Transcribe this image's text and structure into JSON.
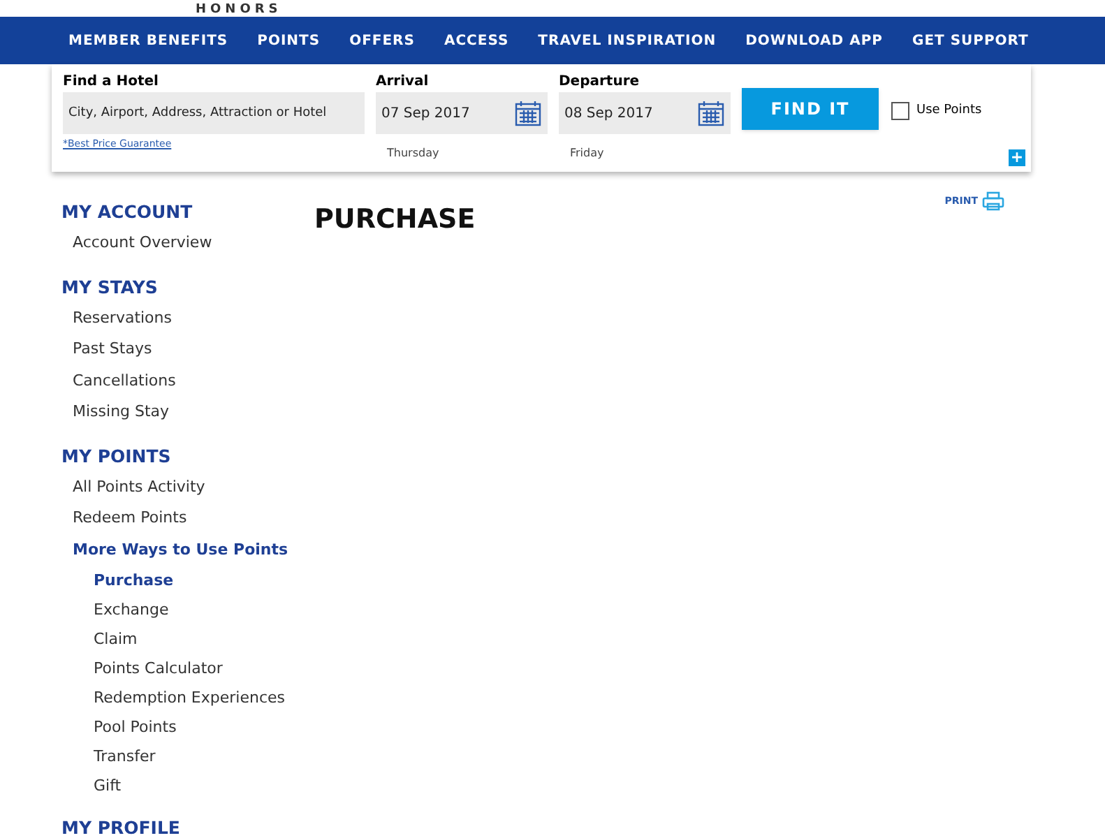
{
  "logo": {
    "text": "HONORS"
  },
  "nav": [
    "MEMBER BENEFITS",
    "POINTS",
    "OFFERS",
    "ACCESS",
    "TRAVEL INSPIRATION",
    "DOWNLOAD APP",
    "GET SUPPORT"
  ],
  "search": {
    "hotel_label": "Find a Hotel",
    "hotel_placeholder": "City, Airport, Address, Attraction or Hotel",
    "guarantee_link": "*Best Price Guarantee",
    "arrival": {
      "label": "Arrival",
      "value": "07 Sep 2017",
      "day": "Thursday"
    },
    "departure": {
      "label": "Departure",
      "value": "08 Sep 2017",
      "day": "Friday"
    },
    "button": "FIND IT",
    "use_points": {
      "label": "Use Points",
      "checked": false
    },
    "more": "+"
  },
  "sidebar": [
    {
      "heading": "MY ACCOUNT",
      "items": [
        {
          "label": "Account Overview",
          "selected": false
        }
      ]
    },
    {
      "heading": "MY STAYS",
      "items": [
        {
          "label": "Reservations",
          "selected": false
        },
        {
          "label": "Past Stays",
          "selected": false
        },
        {
          "label": "Cancellations",
          "selected": false
        },
        {
          "label": "Missing Stay",
          "selected": false
        }
      ]
    },
    {
      "heading": "MY POINTS",
      "items": [
        {
          "label": "All Points Activity",
          "selected": false
        },
        {
          "label": "Redeem Points",
          "selected": false
        },
        {
          "label": "More Ways to Use Points",
          "selected": false,
          "expanded": true,
          "children": [
            {
              "label": "Purchase",
              "selected": true
            },
            {
              "label": "Exchange",
              "selected": false
            },
            {
              "label": "Claim",
              "selected": false
            },
            {
              "label": "Points Calculator",
              "selected": false
            },
            {
              "label": "Redemption Experiences",
              "selected": false
            },
            {
              "label": "Pool Points",
              "selected": false
            },
            {
              "label": "Transfer",
              "selected": false
            },
            {
              "label": "Gift",
              "selected": false
            }
          ]
        }
      ]
    },
    {
      "heading": "MY PROFILE"
    }
  ],
  "page_title": "PURCHASE",
  "print": "PRINT"
}
